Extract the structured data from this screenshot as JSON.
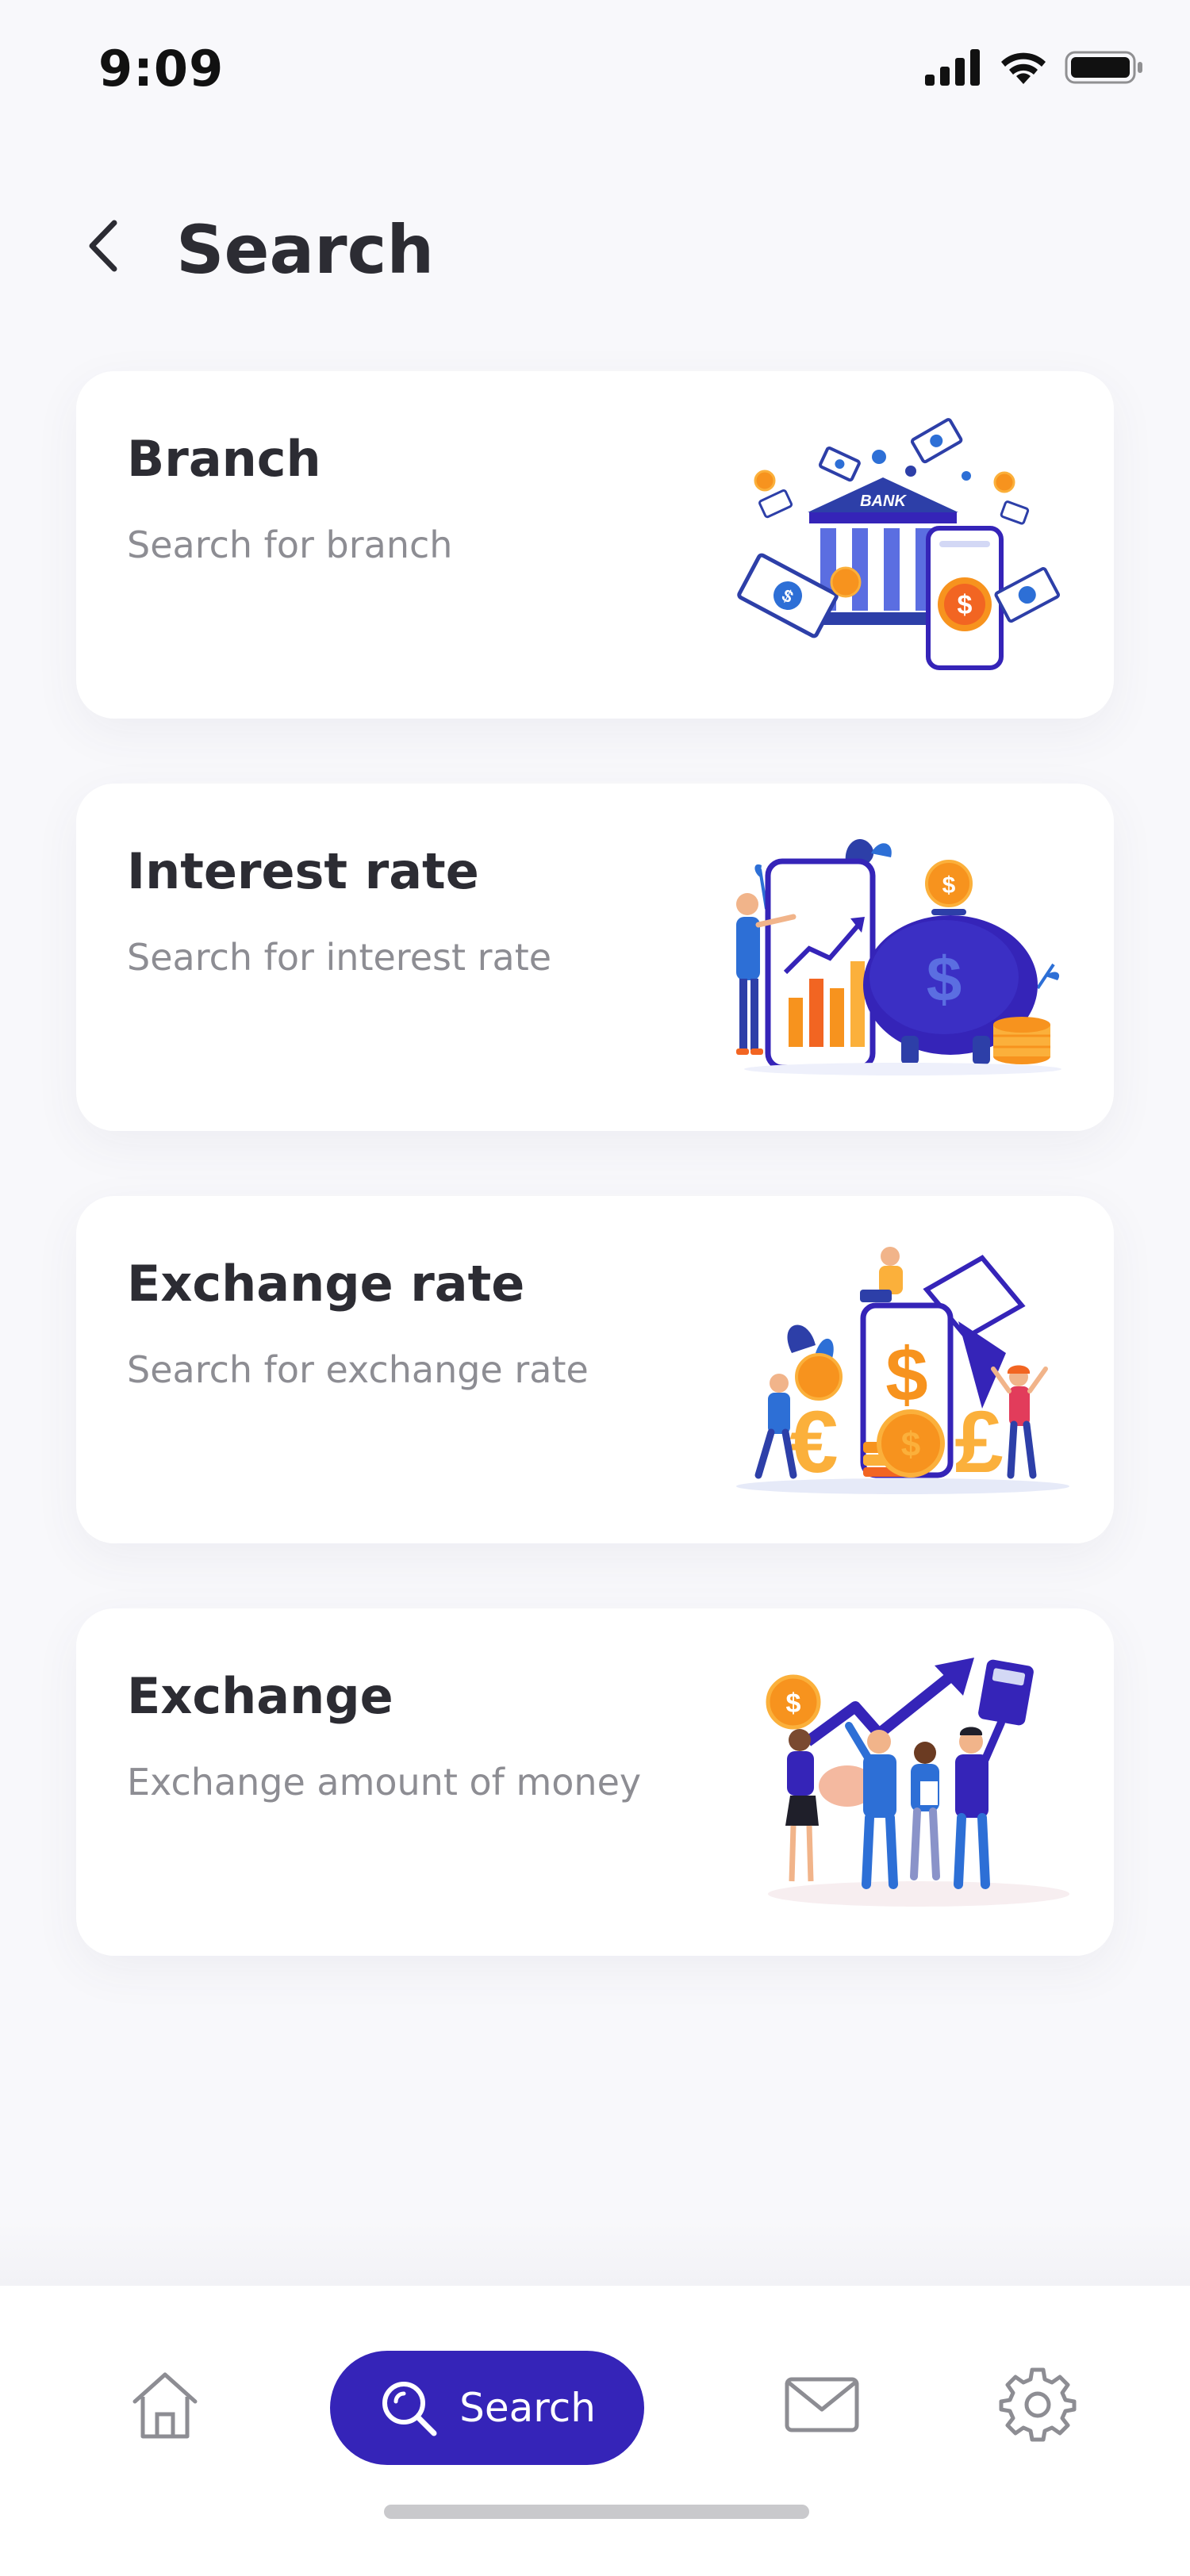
{
  "status_bar": {
    "time": "9:09",
    "icons": [
      "signal-icon",
      "wifi-icon",
      "battery-icon"
    ]
  },
  "header": {
    "back_icon": "chevron-left-icon",
    "title": "Search"
  },
  "cards": [
    {
      "title": "Branch",
      "subtitle": "Search for branch",
      "illustration": "bank-illustration",
      "illustration_text": "BANK"
    },
    {
      "title": "Interest rate",
      "subtitle": "Search for interest rate",
      "illustration": "piggy-bank-growth-illustration"
    },
    {
      "title": "Exchange rate",
      "subtitle": "Search for exchange rate",
      "illustration": "currency-exchange-illustration"
    },
    {
      "title": "Exchange",
      "subtitle": "Exchange amount of money",
      "illustration": "team-celebration-illustration"
    }
  ],
  "bottom_nav": {
    "items": [
      {
        "icon": "home-icon"
      },
      {
        "icon": "search-icon",
        "label": "Search",
        "active": true
      },
      {
        "icon": "mail-icon"
      },
      {
        "icon": "gear-icon"
      }
    ]
  },
  "colors": {
    "accent": "#3524b8",
    "background": "#f8f8fb",
    "card": "#ffffff",
    "title_text": "#2c2c33",
    "subtitle_text": "#8d8d93",
    "orange": "#f7931e",
    "blue": "#2d6fd6"
  }
}
